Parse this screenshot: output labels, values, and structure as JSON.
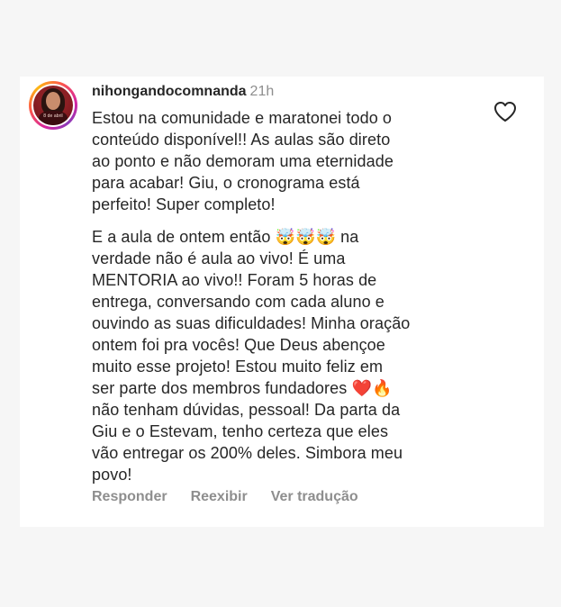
{
  "comment": {
    "username": "nihongandocomnanda",
    "time": "21h",
    "avatar_caption": "8 de abril",
    "paragraph_1": "Estou na comunidade e maratonei todo o\nconteúdo disponível!! As aulas são direto\nao ponto e não demoram uma eternidade\npara acabar! Giu, o cronograma está\nperfeito! Super completo!",
    "paragraph_2": "E a aula de ontem então 🤯🤯🤯 na\nverdade não é aula ao vivo! É uma\nMENTORIA ao vivo!! Foram 5 horas de\nentrega, conversando com cada aluno e\nouvindo as suas dificuldades! Minha oração\nontem foi pra vocês! Que Deus abençoe\nmuito esse projeto! Estou muito feliz em\nser parte dos membros fundadores ❤️🔥\nnão tenham dúvidas, pessoal! Da parta da\nGiu e o Estevam, tenho certeza que eles\nvão entregar os 200% deles. Simbora meu\npovo!",
    "actions": {
      "reply": "Responder",
      "show": "Reexibir",
      "translate": "Ver tradução"
    },
    "like_icon": "heart-outline-icon"
  }
}
